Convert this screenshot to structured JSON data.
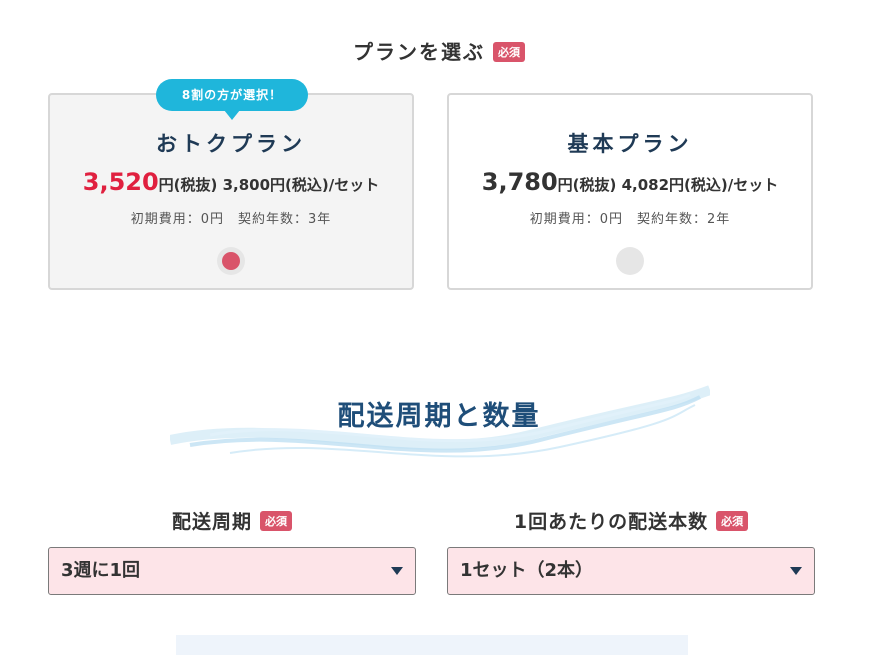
{
  "plan_section": {
    "heading": "プランを選ぶ",
    "required_label": "必須",
    "plans": [
      {
        "badge": "8割の方が選択！",
        "name": "おトクプラン",
        "price_main": "3,520",
        "price_rest": "円(税抜) 3,800円(税込)/セット",
        "meta": "初期費用：0円　契約年数：3年",
        "selected": true
      },
      {
        "name": "基本プラン",
        "price_main": "3,780",
        "price_rest": "円(税抜) 4,082円(税込)/セット",
        "meta": "初期費用：0円　契約年数：2年",
        "selected": false
      }
    ]
  },
  "delivery_section": {
    "heading": "配送周期と数量",
    "cycle": {
      "label": "配送周期",
      "required_label": "必須",
      "value": "3週に1回"
    },
    "quantity": {
      "label": "1回あたりの配送本数",
      "required_label": "必須",
      "value": "1セット（2本）"
    }
  },
  "colors": {
    "accent_red": "#e0203f",
    "required_badge": "#d9546a",
    "badge_blue": "#1fb6db",
    "title_navy": "#1f4e79",
    "select_bg": "#fde4e8"
  },
  "icons": {
    "dropdown": "chevron-down-icon",
    "radio_selected": "radio-checked-icon",
    "radio_unselected": "radio-unchecked-icon"
  }
}
